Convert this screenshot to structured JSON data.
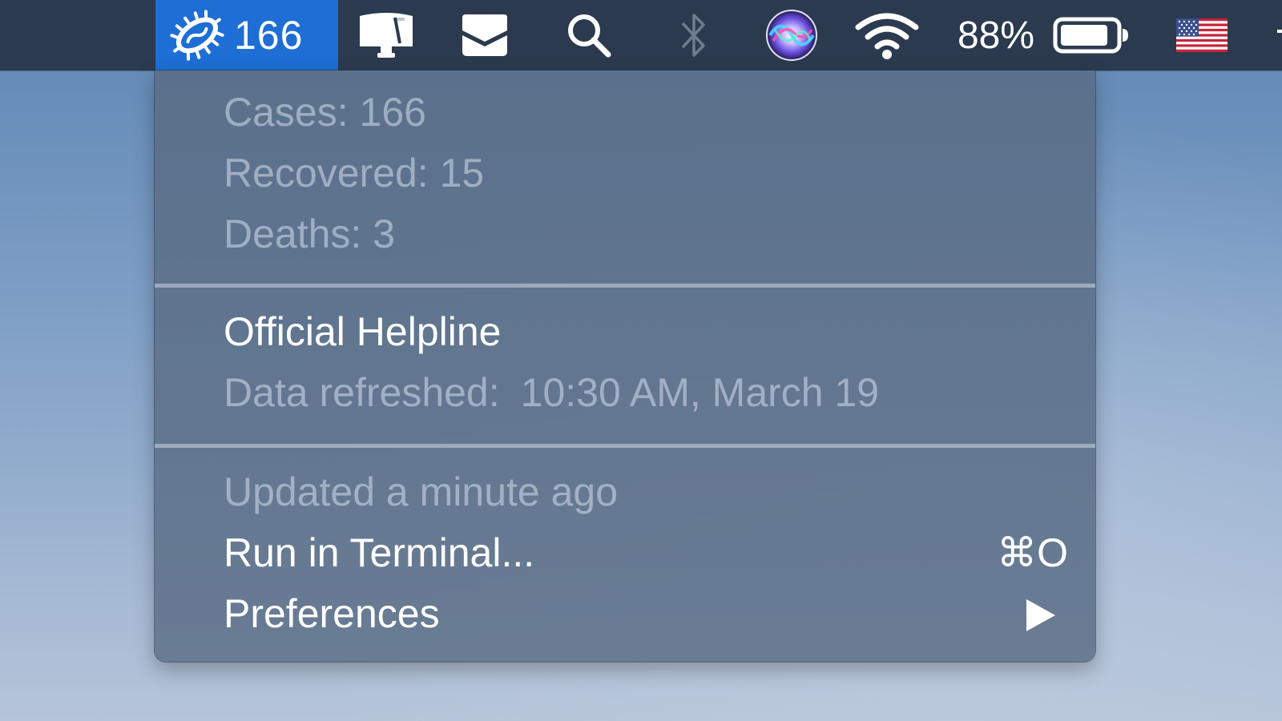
{
  "menubar": {
    "virus_count": "166",
    "battery_percent": "88%",
    "battery_level": 0.88,
    "icons": {
      "virus": "virus-icon",
      "notes": "notes-icon",
      "inbox": "inbox-icon",
      "search": "search-icon",
      "bluetooth": "bluetooth-icon",
      "siri": "siri-icon",
      "wifi": "wifi-icon",
      "battery": "battery-icon",
      "input_source": "us-flag-icon"
    },
    "accent_color": "#1e6ed6",
    "bar_color": "#2b3a4e"
  },
  "menu": {
    "stats": {
      "cases": "Cases: 166",
      "recovered": "Recovered: 15",
      "deaths": "Deaths: 3"
    },
    "helpline": "Official Helpline",
    "refreshed_label": "Data refreshed:",
    "refreshed_value": "10:30 AM, March 19",
    "updated": "Updated a minute ago",
    "run_terminal": "Run in Terminal...",
    "run_terminal_shortcut": "⌘O",
    "preferences": "Preferences"
  }
}
